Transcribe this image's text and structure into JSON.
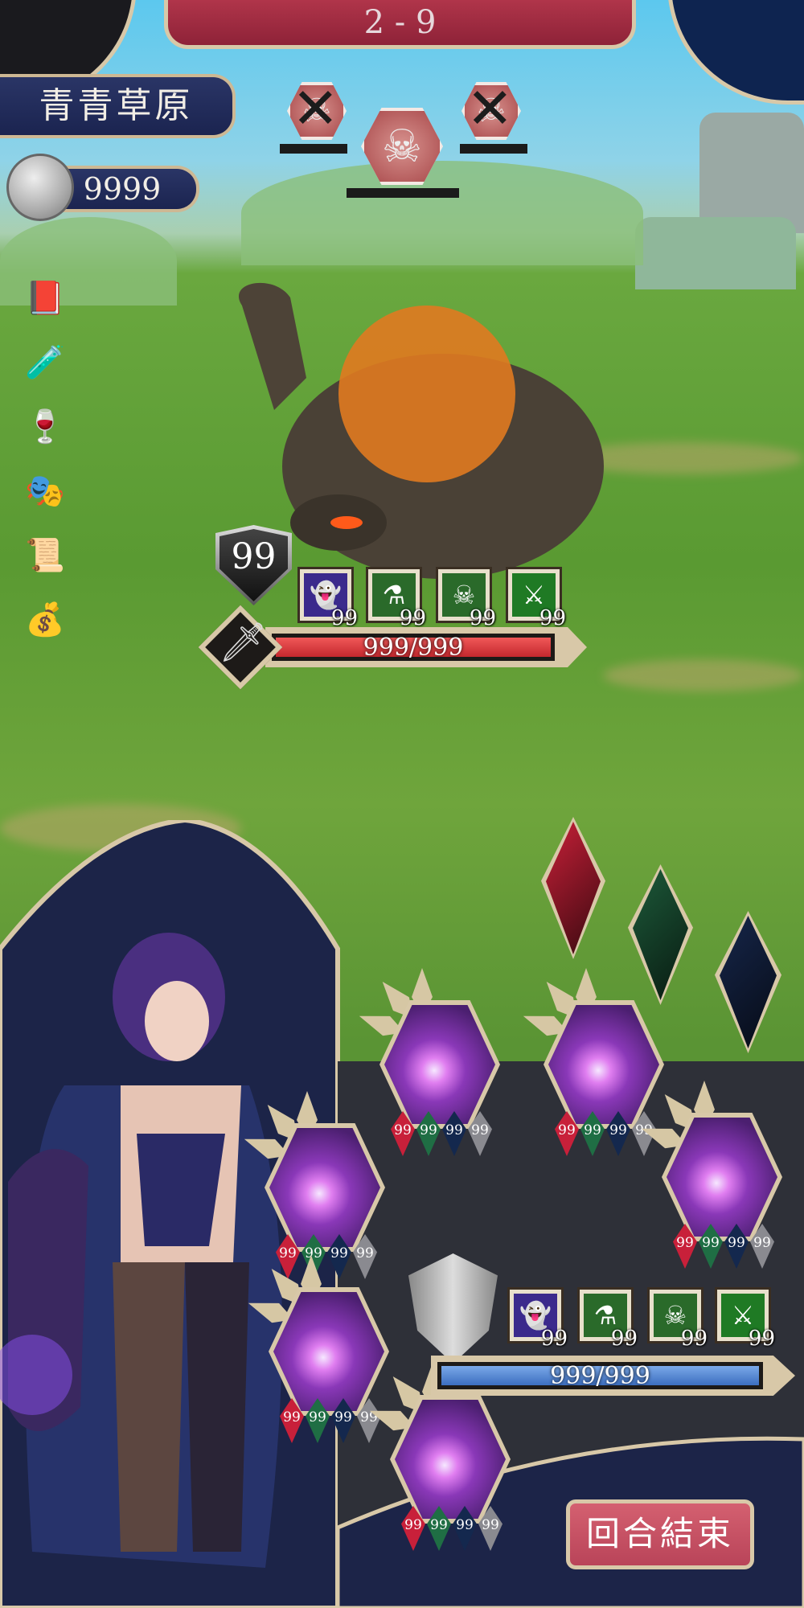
{
  "stage": {
    "label": "2 - 9"
  },
  "location": {
    "name": "青青草原"
  },
  "currency": {
    "icon": "silver-coin-icon",
    "amount": "9999"
  },
  "enemy_queue": [
    {
      "icon": "skull-icon",
      "defeated": true
    },
    {
      "icon": "skull-icon",
      "defeated": false,
      "current": true
    },
    {
      "icon": "skull-icon",
      "defeated": true
    }
  ],
  "items": [
    "spellbook-icon",
    "red-potion-icon",
    "small-red-potion-icon",
    "hooded-mask-icon",
    "scroll-icon",
    "gold-pouch-icon"
  ],
  "enemy": {
    "armor": "99",
    "hp": "999/999",
    "hp_fraction": 1.0,
    "statuses": [
      {
        "icon": "ghost-curse-icon",
        "count": "99",
        "color": "#3b2a8c"
      },
      {
        "icon": "poison-flask-icon",
        "count": "99",
        "color": "#2a6a2a"
      },
      {
        "icon": "toxic-skull-icon",
        "count": "99",
        "color": "#2a6a2a"
      },
      {
        "icon": "attack-up-icon",
        "count": "99",
        "color": "#1f7a24"
      }
    ],
    "intent": "dagger-icon"
  },
  "mana_gems": [
    {
      "color": "#c82038"
    },
    {
      "color": "#1d5a3a"
    },
    {
      "color": "#16264a"
    }
  ],
  "cards": [
    {
      "costs": [
        "99",
        "99",
        "99",
        "99"
      ]
    },
    {
      "costs": [
        "99",
        "99",
        "99",
        "99"
      ]
    },
    {
      "costs": [
        "99",
        "99",
        "99",
        "99"
      ]
    },
    {
      "costs": [
        "99",
        "99",
        "99",
        "99"
      ]
    },
    {
      "costs": [
        "99",
        "99",
        "99",
        "99"
      ]
    },
    {
      "costs": [
        "99",
        "99",
        "99",
        "99"
      ]
    }
  ],
  "pip_colors": [
    "#c8203a",
    "#1f6e44",
    "#14284e",
    "#8a8a90"
  ],
  "player": {
    "hp": "999/999",
    "hp_fraction": 1.0,
    "statuses": [
      {
        "icon": "ghost-curse-icon",
        "count": "99",
        "color": "#3b2a8c"
      },
      {
        "icon": "poison-flask-icon",
        "count": "99",
        "color": "#2a6a2a"
      },
      {
        "icon": "toxic-skull-icon",
        "count": "99",
        "color": "#2a6a2a"
      },
      {
        "icon": "attack-up-icon",
        "count": "99",
        "color": "#1f7a24"
      }
    ]
  },
  "end_turn": {
    "label": "回合結束"
  }
}
